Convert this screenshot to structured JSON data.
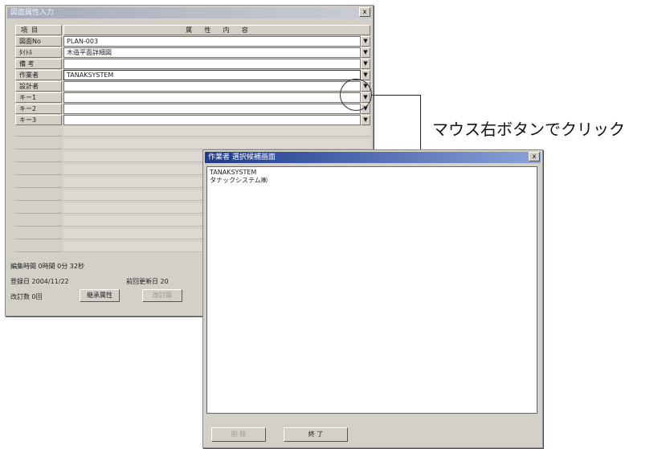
{
  "main_window": {
    "title": "図面属性入力",
    "close_label": "x",
    "header": {
      "col1": "項  目",
      "col2": "属      性      内      容"
    },
    "rows": [
      {
        "label": "図面No",
        "value": "PLAN-003",
        "has_drop": true
      },
      {
        "label": "ﾀｲﾄﾙ",
        "value": "木造平面詳細図",
        "has_drop": true
      },
      {
        "label": "備  考",
        "value": "",
        "has_drop": true
      },
      {
        "label": "作業者",
        "value": "TANAKSYSTEM",
        "has_drop": true
      },
      {
        "label": "設計者",
        "value": "",
        "has_drop": true
      },
      {
        "label": "キー1",
        "value": "",
        "has_drop": true
      },
      {
        "label": "キー2",
        "value": "",
        "has_drop": true
      },
      {
        "label": "キー3",
        "value": "",
        "has_drop": true
      }
    ],
    "edit_time": "編集時間 0時間 0分 32秒",
    "register_date": "登録日 2004/11/22",
    "update_date": "前回更新日 20",
    "revision": "改訂数 0回",
    "btn_inherit": "継承属性",
    "btn_revision": "改訂図",
    "drop_glyph": "▼"
  },
  "popup": {
    "title": "作業者 選択候補画面",
    "close_label": "x",
    "items": [
      "TANAKSYSTEM",
      "タナックシステム㈱"
    ],
    "btn_delete": "削 除",
    "btn_ok": "終 了"
  },
  "annotation": {
    "text": "マウス右ボタンでクリック"
  }
}
